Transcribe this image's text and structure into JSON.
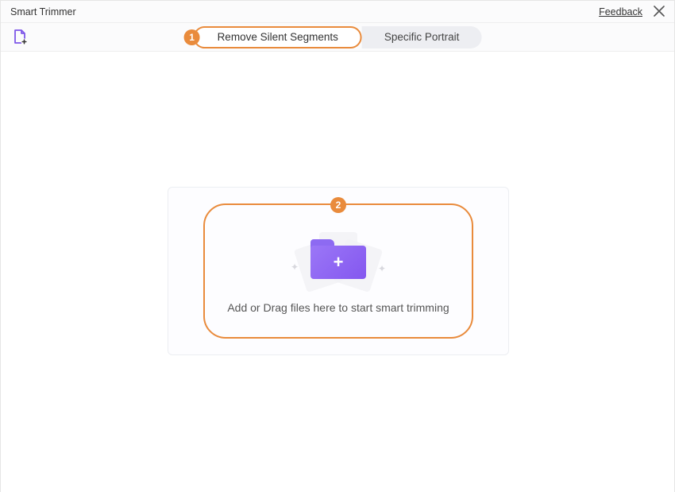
{
  "titlebar": {
    "title": "Smart Trimmer",
    "feedback": "Feedback"
  },
  "tabs": {
    "remove_silent": "Remove Silent Segments",
    "specific_portrait": "Specific Portrait"
  },
  "callouts": {
    "one": "1",
    "two": "2"
  },
  "dropzone": {
    "text": "Add or Drag files here to start smart trimming"
  }
}
